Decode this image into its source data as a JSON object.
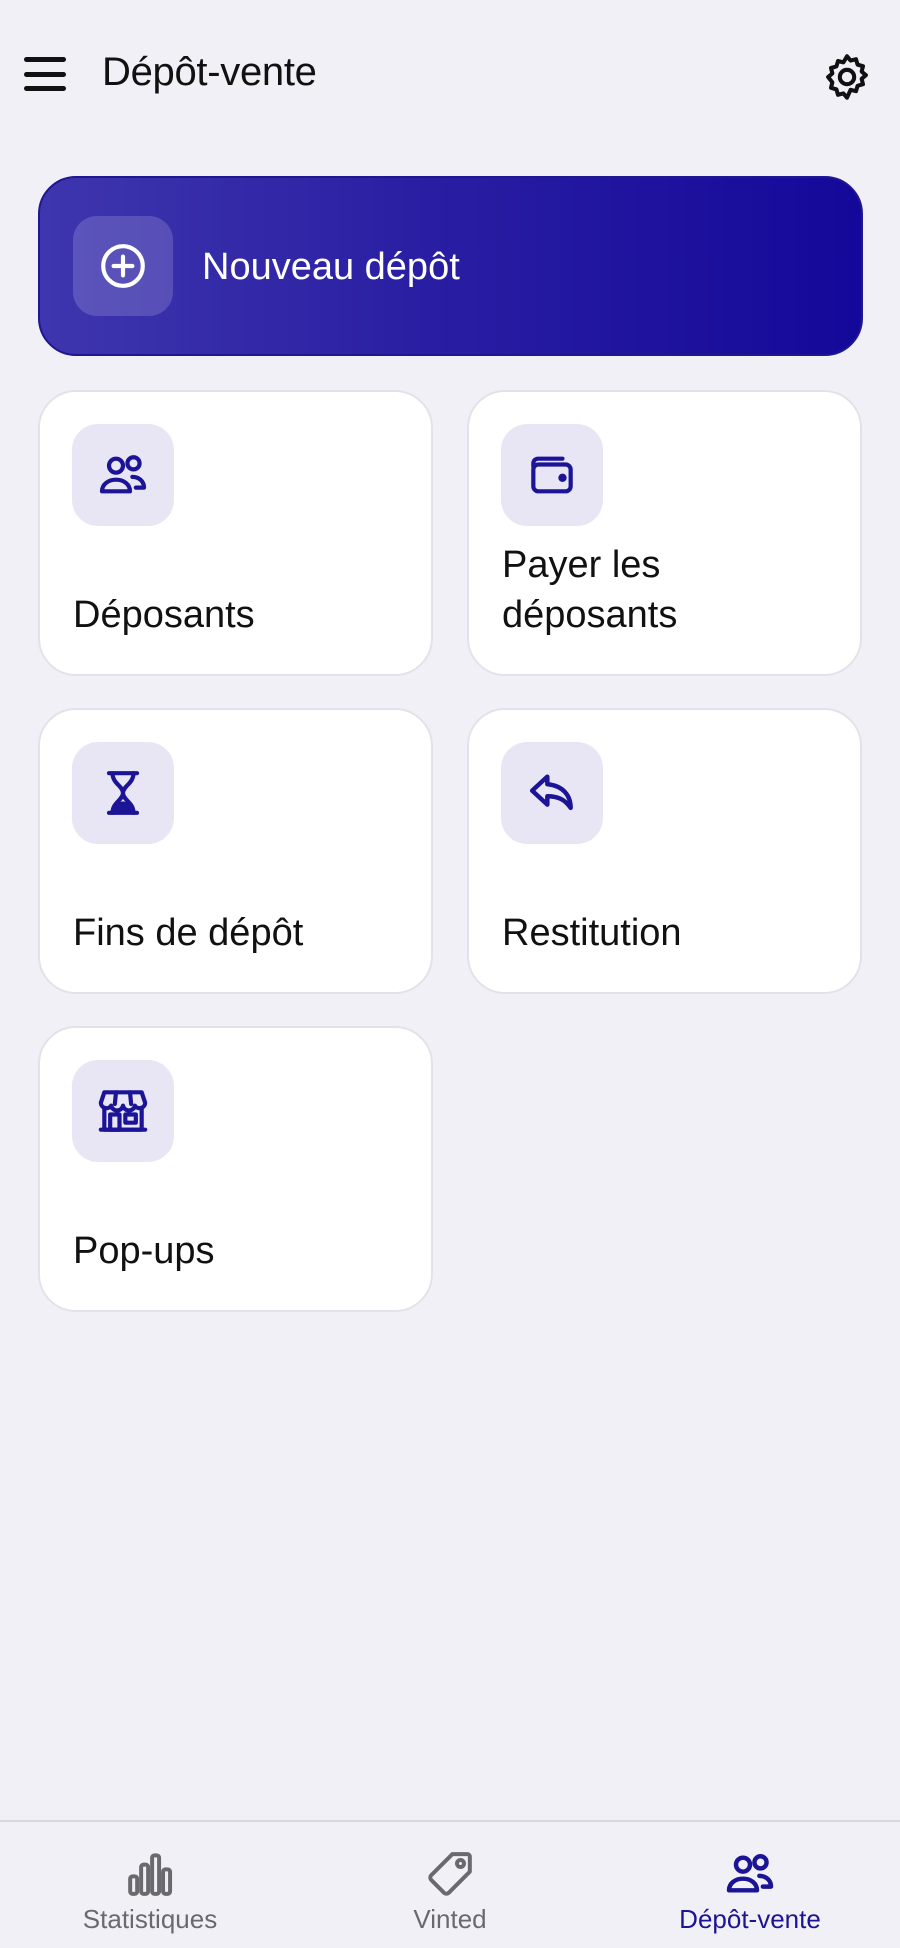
{
  "header": {
    "title": "Dépôt-vente",
    "menu_icon": "hamburger-menu-icon",
    "settings_icon": "gear-icon"
  },
  "hero": {
    "label": "Nouveau dépôt",
    "icon": "plus-circle-icon"
  },
  "tiles": [
    {
      "label": "Déposants",
      "icon": "users-icon"
    },
    {
      "label": "Payer les déposants",
      "icon": "wallet-icon"
    },
    {
      "label": "Fins de dépôt",
      "icon": "hourglass-icon"
    },
    {
      "label": "Restitution",
      "icon": "reply-arrow-icon"
    },
    {
      "label": "Pop-ups",
      "icon": "storefront-icon"
    }
  ],
  "bottom_nav": {
    "items": [
      {
        "label": "Statistiques",
        "icon": "bar-chart-icon",
        "active": false
      },
      {
        "label": "Vinted",
        "icon": "tag-icon",
        "active": false
      },
      {
        "label": "Dépôt-vente",
        "icon": "users-icon",
        "active": true
      }
    ]
  },
  "colors": {
    "accent": "#1c1496",
    "background": "#f1f0f6",
    "tile_icon_bg": "#e8e6f4",
    "inactive_nav": "#6a6a6e"
  }
}
